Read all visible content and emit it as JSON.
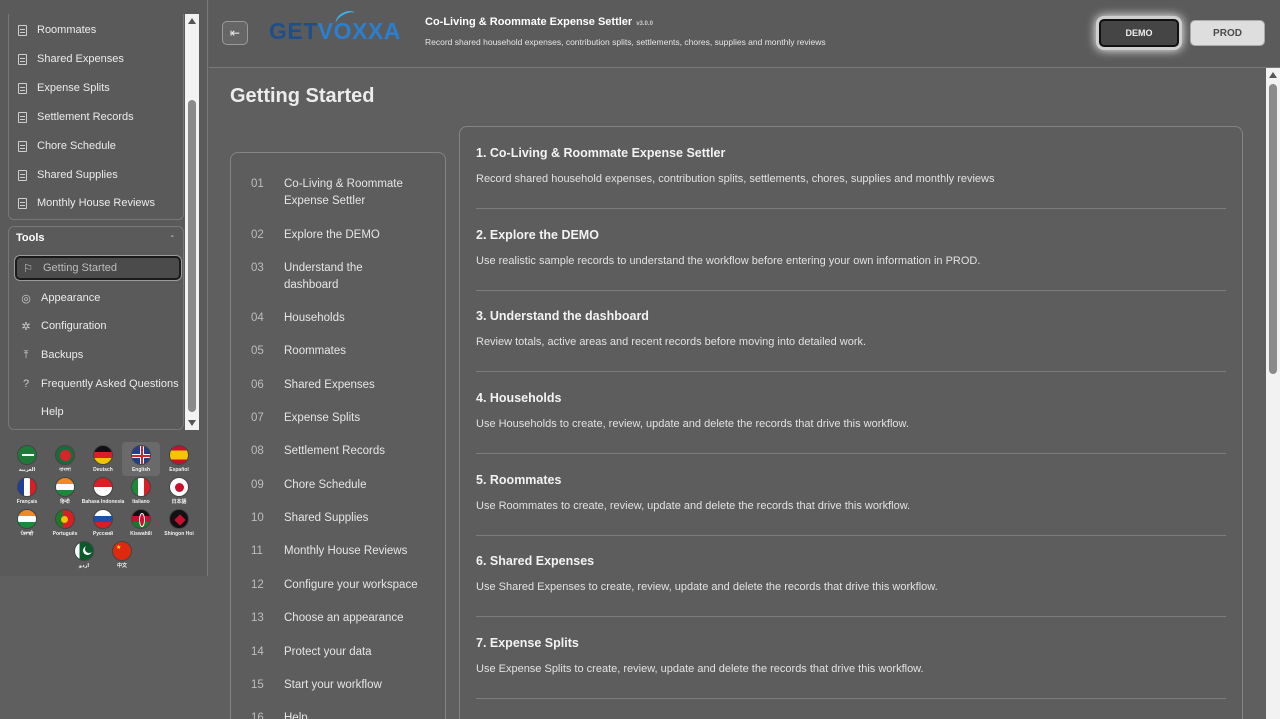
{
  "sidebar": {
    "nav_items": [
      {
        "label": "Roommates",
        "icon": "document-icon"
      },
      {
        "label": "Shared Expenses",
        "icon": "document-icon"
      },
      {
        "label": "Expense Splits",
        "icon": "document-icon"
      },
      {
        "label": "Settlement Records",
        "icon": "document-icon"
      },
      {
        "label": "Chore Schedule",
        "icon": "document-icon"
      },
      {
        "label": "Shared Supplies",
        "icon": "document-icon"
      },
      {
        "label": "Monthly House Reviews",
        "icon": "document-icon"
      }
    ],
    "tools_title": "Tools",
    "tools_toggle": "-",
    "tools": [
      {
        "label": "Getting Started",
        "icon": "rocket-icon",
        "glyph": "⚐",
        "active": true
      },
      {
        "label": "Appearance",
        "icon": "palette-icon",
        "glyph": "◎"
      },
      {
        "label": "Configuration",
        "icon": "gear-icon",
        "glyph": "✲"
      },
      {
        "label": "Backups",
        "icon": "upload-icon",
        "glyph": "⤒"
      },
      {
        "label": "Frequently Asked Questions",
        "icon": "help-circle-icon",
        "glyph": "?"
      },
      {
        "label": "Help",
        "icon": "",
        "glyph": ""
      }
    ],
    "languages": [
      {
        "label": "العربية",
        "flag": "sa"
      },
      {
        "label": "বাংলা",
        "flag": "bd"
      },
      {
        "label": "Deutsch",
        "flag": "de"
      },
      {
        "label": "English",
        "flag": "gb",
        "selected": true
      },
      {
        "label": "Español",
        "flag": "es"
      },
      {
        "label": "Français",
        "flag": "fr"
      },
      {
        "label": "हिन्दी",
        "flag": "in"
      },
      {
        "label": "Bahasa Indonesia",
        "flag": "id"
      },
      {
        "label": "Italiano",
        "flag": "it"
      },
      {
        "label": "日本語",
        "flag": "jp"
      },
      {
        "label": "ਪੰਜਾਬੀ",
        "flag": "in"
      },
      {
        "label": "Português",
        "flag": "pt"
      },
      {
        "label": "Русский",
        "flag": "ru"
      },
      {
        "label": "Kiswahili",
        "flag": "ke"
      },
      {
        "label": "Shingon Hoi",
        "flag": "other"
      },
      {
        "label": "اردو",
        "flag": "pk"
      },
      {
        "label": "中文",
        "flag": "cn"
      }
    ]
  },
  "header": {
    "logo_text_1": "GET",
    "logo_text_2": "V",
    "logo_text_3": "OXXA",
    "app_title": "Co-Living & Roommate Expense Settler",
    "app_version": "v3.0.0",
    "app_subtitle": "Record shared household expenses, contribution splits, settlements, chores, supplies and monthly reviews",
    "demo_label": "DEMO",
    "prod_label": "PROD"
  },
  "main": {
    "page_title": "Getting Started",
    "toc": [
      {
        "num": "01",
        "label": "Co-Living & Roommate Expense Settler"
      },
      {
        "num": "02",
        "label": "Explore the DEMO"
      },
      {
        "num": "03",
        "label": "Understand the dashboard"
      },
      {
        "num": "04",
        "label": "Households"
      },
      {
        "num": "05",
        "label": "Roommates"
      },
      {
        "num": "06",
        "label": "Shared Expenses"
      },
      {
        "num": "07",
        "label": "Expense Splits"
      },
      {
        "num": "08",
        "label": "Settlement Records"
      },
      {
        "num": "09",
        "label": "Chore Schedule"
      },
      {
        "num": "10",
        "label": "Shared Supplies"
      },
      {
        "num": "11",
        "label": "Monthly House Reviews"
      },
      {
        "num": "12",
        "label": "Configure your workspace"
      },
      {
        "num": "13",
        "label": "Choose an appearance"
      },
      {
        "num": "14",
        "label": "Protect your data"
      },
      {
        "num": "15",
        "label": "Start your workflow"
      },
      {
        "num": "16",
        "label": "Help"
      }
    ],
    "sections": [
      {
        "title": "1. Co-Living & Roommate Expense Settler",
        "desc": "Record shared household expenses, contribution splits, settlements, chores, supplies and monthly reviews"
      },
      {
        "title": "2. Explore the DEMO",
        "desc": "Use realistic sample records to understand the workflow before entering your own information in PROD."
      },
      {
        "title": "3. Understand the dashboard",
        "desc": "Review totals, active areas and recent records before moving into detailed work."
      },
      {
        "title": "4. Households",
        "desc": "Use Households to create, review, update and delete the records that drive this workflow."
      },
      {
        "title": "5. Roommates",
        "desc": "Use Roommates to create, review, update and delete the records that drive this workflow."
      },
      {
        "title": "6. Shared Expenses",
        "desc": "Use Shared Expenses to create, review, update and delete the records that drive this workflow."
      },
      {
        "title": "7. Expense Splits",
        "desc": "Use Expense Splits to create, review, update and delete the records that drive this workflow."
      }
    ]
  }
}
